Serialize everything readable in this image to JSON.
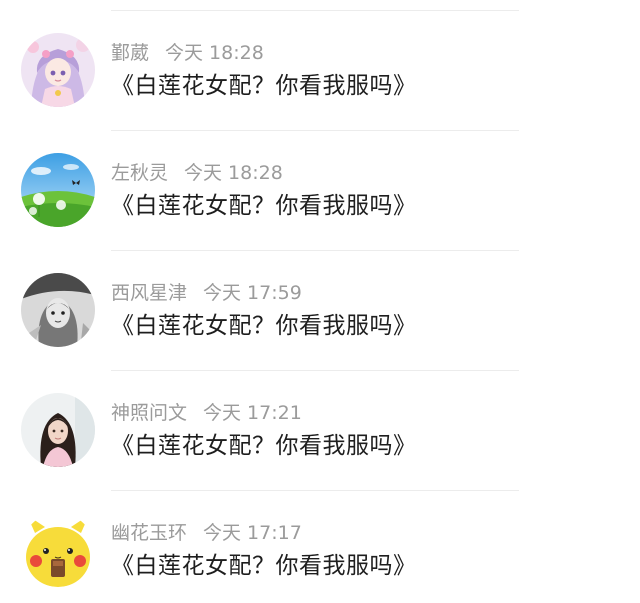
{
  "items": [
    {
      "user": "鄞葳",
      "time": "今天 18:28",
      "title": "《白莲花女配？你看我服吗》",
      "avatar_icon": "anime-girl-avatar"
    },
    {
      "user": "左秋灵",
      "time": "今天 18:28",
      "title": "《白莲花女配？你看我服吗》",
      "avatar_icon": "dandelion-meadow-avatar"
    },
    {
      "user": "西风星津",
      "time": "今天 17:59",
      "title": "《白莲花女配？你看我服吗》",
      "avatar_icon": "monochrome-sketch-avatar"
    },
    {
      "user": "神照问文",
      "time": "今天 17:21",
      "title": "《白莲花女配？你看我服吗》",
      "avatar_icon": "girl-photo-avatar"
    },
    {
      "user": "幽花玉环",
      "time": "今天 17:17",
      "title": "《白莲花女配？你看我服吗》",
      "avatar_icon": "pikachu-avatar"
    }
  ]
}
